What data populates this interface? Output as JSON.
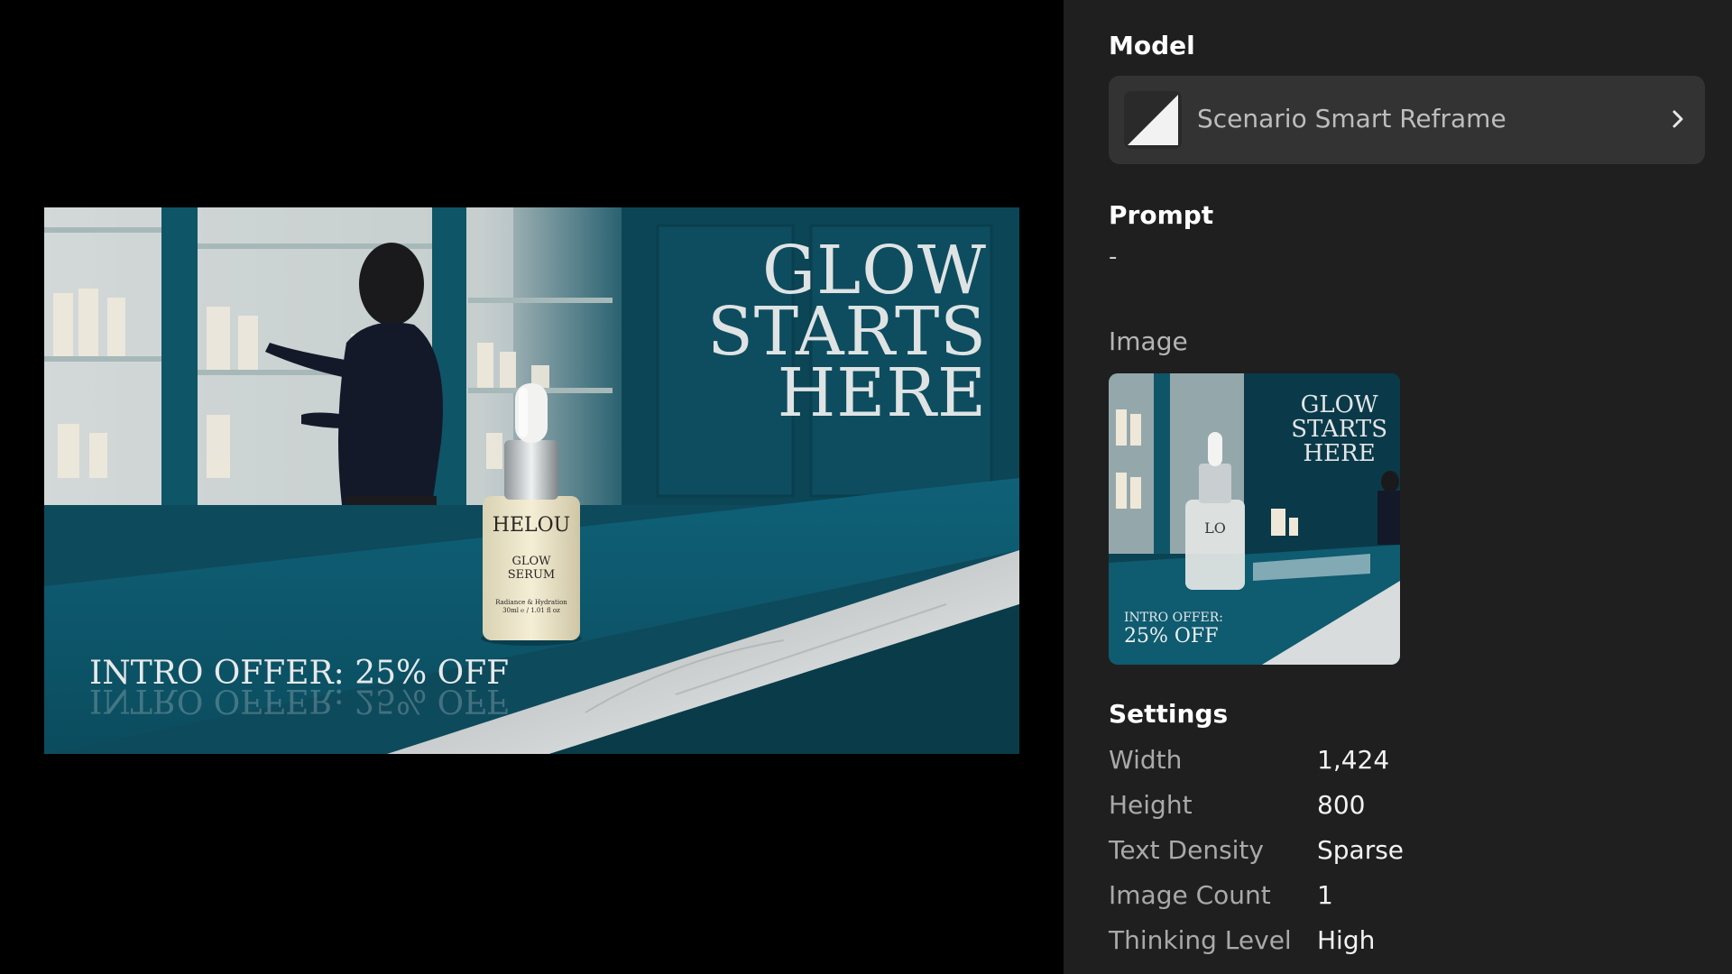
{
  "canvas": {
    "headline": "GLOW\nSTARTS\nHERE",
    "offer_text": "INTRO OFFER: 25% OFF",
    "bottle": {
      "brand": "HELOU",
      "name": "GLOW\nSERUM",
      "sub": "Radiance & Hydration\n30ml ℮ / 1.01 fl oz"
    }
  },
  "panel": {
    "model": {
      "title": "Model",
      "name": "Scenario Smart Reframe",
      "chevron_icon": "chevron-right-icon"
    },
    "prompt": {
      "title": "Prompt",
      "value": "-"
    },
    "image": {
      "label": "Image",
      "thumb_headline": "GLOW\nSTARTS\nHERE",
      "thumb_offer_small": "INTRO OFFER:",
      "thumb_offer_big": "25% OFF",
      "thumb_brand": "LO"
    },
    "settings": {
      "title": "Settings",
      "rows": [
        {
          "label": "Width",
          "value": "1,424"
        },
        {
          "label": "Height",
          "value": "800"
        },
        {
          "label": "Text Density",
          "value": "Sparse"
        },
        {
          "label": "Image Count",
          "value": "1"
        },
        {
          "label": "Thinking Level",
          "value": "High"
        }
      ]
    }
  },
  "colors": {
    "panel_bg": "#1f1f1f",
    "card_bg": "#333333",
    "teal": "#0b4556"
  }
}
